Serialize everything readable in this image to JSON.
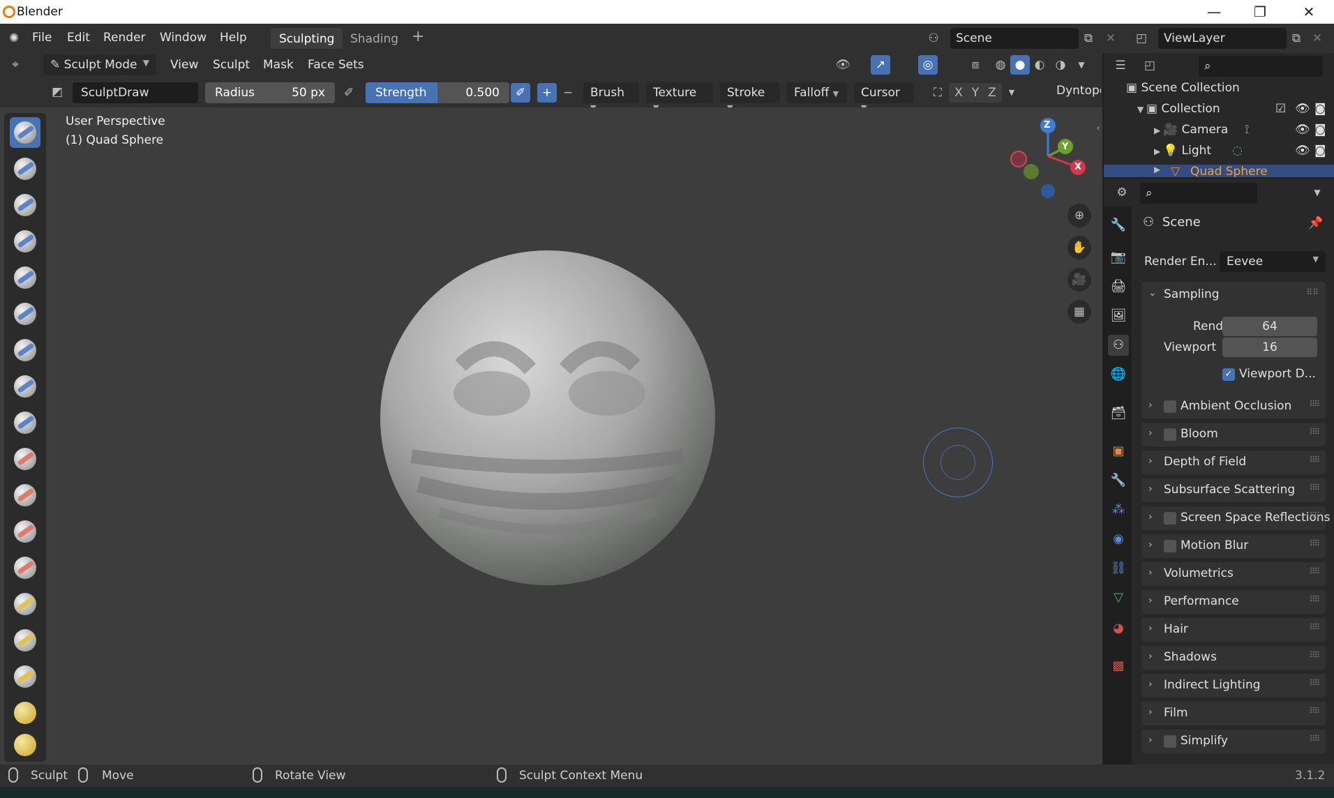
{
  "app": {
    "title": "Blender",
    "version": "3.1.2"
  },
  "window_controls": {
    "minimize": "—",
    "restore": "❐",
    "close": "✕"
  },
  "menu": [
    "File",
    "Edit",
    "Render",
    "Window",
    "Help"
  ],
  "workspaces": [
    {
      "label": "Sculpting",
      "active": true
    },
    {
      "label": "Shading",
      "active": false
    }
  ],
  "add_workspace": "+",
  "scene": {
    "name": "Scene"
  },
  "view_layer": {
    "name": "ViewLayer"
  },
  "header": {
    "mode": "Sculpt Mode",
    "menus": [
      "View",
      "Sculpt",
      "Mask",
      "Face Sets"
    ]
  },
  "tool_settings": {
    "brush_name": "SculptDraw",
    "radius": {
      "label": "Radius",
      "value": "50 px"
    },
    "strength": {
      "label": "Strength",
      "value": "0.500",
      "fraction": 0.5
    },
    "direction_add": "+",
    "direction_sub": "−",
    "dropdowns": [
      "Brush",
      "Texture",
      "Stroke",
      "Falloff",
      "Cursor"
    ],
    "symmetry": [
      "X",
      "Y",
      "Z"
    ],
    "dyntopo": "Dyntopo"
  },
  "viewport": {
    "perspective": "User Perspective",
    "object": "(1) Quad Sphere",
    "gizmo": {
      "z": "Z",
      "y": "Y",
      "x": "X"
    },
    "accent": "#4772b3"
  },
  "outliner": {
    "root": "Scene Collection",
    "items": [
      {
        "label": "Collection"
      },
      {
        "label": "Camera"
      },
      {
        "label": "Light"
      },
      {
        "label": "Quad Sphere",
        "selected": true
      }
    ]
  },
  "properties": {
    "context": "Scene",
    "render_engine_label": "Render En...",
    "render_engine_value": "Eevee",
    "sampling": {
      "title": "Sampling",
      "render_label": "Render",
      "render_value": "64",
      "viewport_label": "Viewport",
      "viewport_value": "16",
      "denoise_label": "Viewport D..."
    },
    "panels": [
      {
        "label": "Ambient Occlusion",
        "checkbox": true
      },
      {
        "label": "Bloom",
        "checkbox": true
      },
      {
        "label": "Depth of Field",
        "checkbox": false
      },
      {
        "label": "Subsurface Scattering",
        "checkbox": false
      },
      {
        "label": "Screen Space Reflections",
        "checkbox": true
      },
      {
        "label": "Motion Blur",
        "checkbox": true
      },
      {
        "label": "Volumetrics",
        "checkbox": false
      },
      {
        "label": "Performance",
        "checkbox": false
      },
      {
        "label": "Hair",
        "checkbox": false
      },
      {
        "label": "Shadows",
        "checkbox": false
      },
      {
        "label": "Indirect Lighting",
        "checkbox": false
      },
      {
        "label": "Film",
        "checkbox": false
      },
      {
        "label": "Simplify",
        "checkbox": true
      }
    ]
  },
  "statusbar": {
    "items": [
      "Sculpt",
      "Move",
      "Rotate View",
      "Sculpt Context Menu"
    ]
  }
}
